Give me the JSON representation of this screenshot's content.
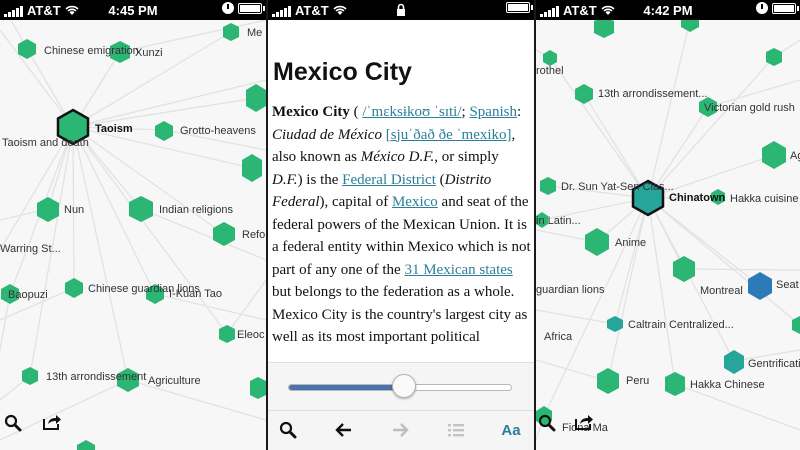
{
  "status_bars": [
    {
      "carrier": "AT&T",
      "time": "4:45 PM"
    },
    {
      "carrier": "AT&T",
      "time": ""
    },
    {
      "carrier": "AT&T",
      "time": "4:42 PM"
    }
  ],
  "left_graph": {
    "center": "Taoism",
    "labels": {
      "chinese_emigration": "Chinese emigration",
      "xunzi": "Xunzi",
      "me": "Me",
      "grotto_heavens": "Grotto-heavens",
      "taoism_and_death": "Taoism and death",
      "nun": "Nun",
      "indian_religions": "Indian religions",
      "refo": "Refo",
      "warring_st": "Warring St...",
      "baopuzi": "Baopuzi",
      "chinese_guardian_lions": "Chinese guardian lions",
      "i_kuan_tao": "I-Kuan Tao",
      "eleoc": "Eleoc",
      "thirteenth_arr": "13th arrondissement",
      "agriculture": "Agriculture"
    }
  },
  "article": {
    "title": "Mexico City",
    "lead_bold": "Mexico City",
    "ipa_en": "/ˈmɛksɨkoʊ ˈsɪti/",
    "spanish_link": "Spanish",
    "spanish_name": "Ciudad de México",
    "ipa_es": "[sjuˈðað ðe ˈmexiko]",
    "aka_prefix": ", also known as ",
    "aka_name": "México D.F.",
    "aka_mid": ", or simply ",
    "aka_short": "D.F.",
    "is_the": ") is the ",
    "federal_district_link": "Federal District",
    "distrito_federal": "Distrito Federal",
    "capital_of": "), capital of ",
    "mexico_link": "Mexico",
    "rest_1": " and seat of the federal powers of the Mexican Union. It is a federal entity within Mexico which is not part of any one of the ",
    "states_link": "31 Mexican states",
    "rest_2": " but belongs to the federation as a whole. Mexico City is the country's largest city as well as its most important political",
    "text_size_slider": 0.52,
    "aa_label": "Aa"
  },
  "right_graph": {
    "center": "Chinatown",
    "labels": {
      "rothel": "rothel",
      "thirteenth_arr": "13th arrondissement...",
      "victorian_gold_rush": "Victorian gold rush",
      "ag": "Ag",
      "dr_sun": "Dr. Sun Yat-Sen Clas...",
      "hakka_cuisine": "Hakka cuisine",
      "in_latin": "in Latin...",
      "anime": "Anime",
      "guardian_lions": "guardian lions",
      "montreal": "Montreal",
      "seat": "Seat",
      "caltrain": "Caltrain Centralized...",
      "africa": "Africa",
      "gentrificati": "Gentrificati",
      "peru": "Peru",
      "hakka_chinese": "Hakka Chinese",
      "fiona_ma": "Fiona Ma"
    }
  },
  "colors": {
    "node_green": "#2bb673",
    "node_teal": "#26a69a",
    "node_blue": "#2c7bb6",
    "edge": "#e4e4e4",
    "link": "#2c7f99"
  }
}
